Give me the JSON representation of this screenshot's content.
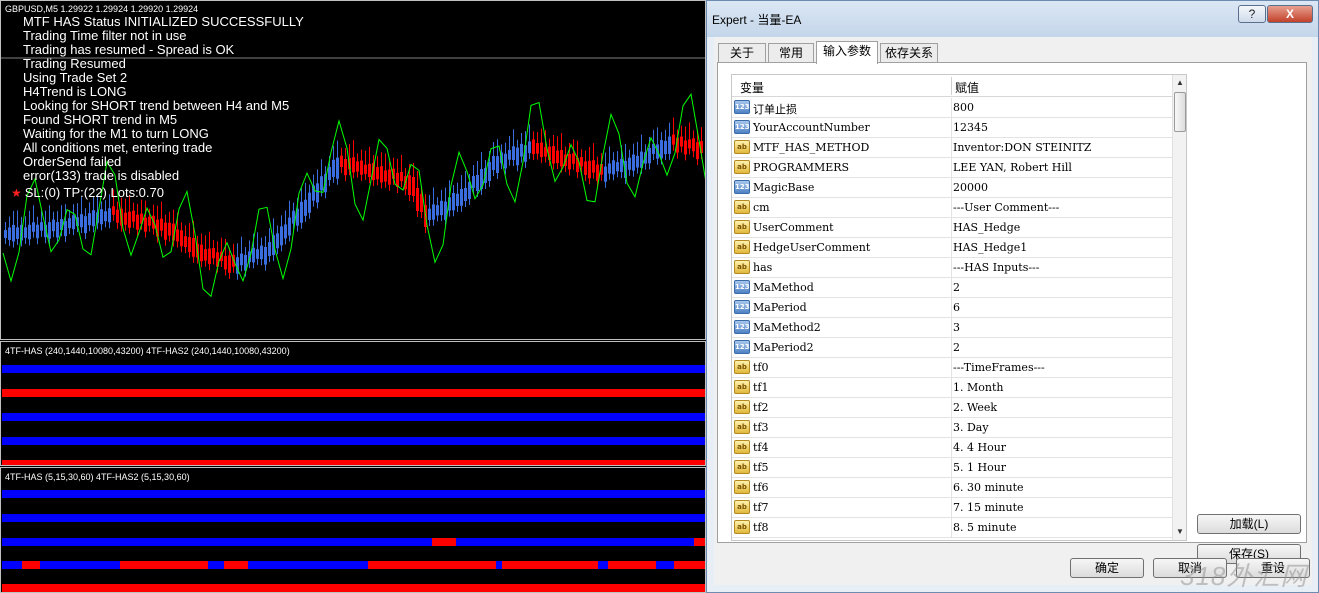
{
  "chart": {
    "symbol_label": "GBPUSD,M5  1.29922 1.29924 1.29920 1.29924",
    "status_lines": [
      "MTF HAS Status INITIALIZED SUCCESSFULLY",
      "Trading Time filter not in use",
      "Trading has resumed - Spread is OK",
      "Trading Resumed",
      "Using Trade Set 2",
      "H4Trend is LONG",
      "Looking for SHORT trend between H4 and M5",
      "Found SHORT trend in M5",
      "Waiting for the M1 to turn LONG",
      "All conditions met, entering trade",
      "OrderSend failed",
      "error(133) trade is disabled"
    ],
    "order_line": "SL:(0) TP:(22) Lots:0.70",
    "indicator1_label": "4TF-HAS (240,1440,10080,43200)  4TF-HAS2 (240,1440,10080,43200)",
    "indicator2_label": "4TF-HAS (5,15,30,60)  4TF-HAS2 (5,15,30,60)",
    "colors": {
      "bull": "#3a6ee0",
      "bear": "#ff0000",
      "line": "#00ff00"
    }
  },
  "dialog": {
    "title": "Expert - 当量-EA",
    "help_label": "?",
    "close_label": "X",
    "tabs": [
      "关于",
      "常用",
      "输入参数",
      "依存关系"
    ],
    "active_tab": "输入参数",
    "columns": {
      "name": "变量",
      "value": "赋值"
    },
    "rows": [
      {
        "icon": "123",
        "name": "订单止损",
        "value": "800"
      },
      {
        "icon": "123",
        "name": "YourAccountNumber",
        "value": "12345"
      },
      {
        "icon": "ab",
        "name": "MTF_HAS_METHOD",
        "value": "Inventor:DON STEINITZ"
      },
      {
        "icon": "ab",
        "name": "PROGRAMMERS",
        "value": "LEE YAN, Robert Hill"
      },
      {
        "icon": "123",
        "name": "MagicBase",
        "value": "20000"
      },
      {
        "icon": "ab",
        "name": "cm",
        "value": "---User Comment---"
      },
      {
        "icon": "ab",
        "name": "UserComment",
        "value": "HAS_Hedge"
      },
      {
        "icon": "ab",
        "name": "HedgeUserComment",
        "value": "HAS_Hedge1"
      },
      {
        "icon": "ab",
        "name": "has",
        "value": "---HAS Inputs---"
      },
      {
        "icon": "123",
        "name": "MaMethod",
        "value": "2"
      },
      {
        "icon": "123",
        "name": "MaPeriod",
        "value": "6"
      },
      {
        "icon": "123",
        "name": "MaMethod2",
        "value": "3"
      },
      {
        "icon": "123",
        "name": "MaPeriod2",
        "value": "2"
      },
      {
        "icon": "ab",
        "name": "tf0",
        "value": "---TimeFrames---"
      },
      {
        "icon": "ab",
        "name": "tf1",
        "value": "1. Month"
      },
      {
        "icon": "ab",
        "name": "tf2",
        "value": "2. Week"
      },
      {
        "icon": "ab",
        "name": "tf3",
        "value": "3. Day"
      },
      {
        "icon": "ab",
        "name": "tf4",
        "value": "4. 4 Hour"
      },
      {
        "icon": "ab",
        "name": "tf5",
        "value": "5. 1 Hour"
      },
      {
        "icon": "ab",
        "name": "tf6",
        "value": "6. 30 minute"
      },
      {
        "icon": "ab",
        "name": "tf7",
        "value": "7. 15 minute"
      },
      {
        "icon": "ab",
        "name": "tf8",
        "value": "8. 5 minute"
      }
    ],
    "load_label": "加载(L)",
    "save_label": "保存(S)",
    "ok_label": "确定",
    "cancel_label": "取消",
    "reset_label": "重设"
  },
  "watermark": "318外汇网"
}
